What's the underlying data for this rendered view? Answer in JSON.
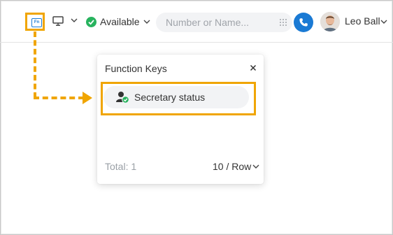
{
  "topbar": {
    "fn_icon_label": "Fn",
    "status_label": "Available",
    "search_placeholder": "Number or Name...",
    "user_name": "Leo Ball"
  },
  "popup": {
    "title": "Function Keys",
    "keys": [
      {
        "label": "Secretary status",
        "icon": "secretary-status-icon"
      }
    ],
    "total_label": "Total: 1",
    "per_row_label": "10 / Row"
  },
  "colors": {
    "accent": "#1a7ad4",
    "status_green": "#27b35e",
    "highlight": "#f0a500"
  }
}
